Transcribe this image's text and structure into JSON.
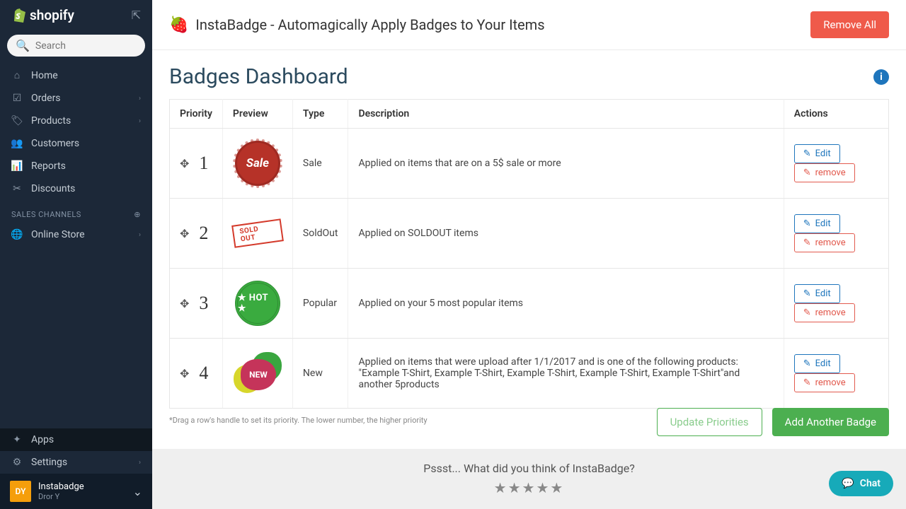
{
  "sidebar": {
    "brand": "shopify",
    "search_placeholder": "Search",
    "items": [
      {
        "label": "Home",
        "icon": "⌂",
        "chev": false
      },
      {
        "label": "Orders",
        "icon": "☑",
        "chev": true
      },
      {
        "label": "Products",
        "icon": "🏷",
        "chev": true
      },
      {
        "label": "Customers",
        "icon": "👥",
        "chev": false
      },
      {
        "label": "Reports",
        "icon": "📊",
        "chev": false
      },
      {
        "label": "Discounts",
        "icon": "✂",
        "chev": false
      }
    ],
    "section": "SALES CHANNELS",
    "channel": {
      "label": "Online Store",
      "icon": "🌐"
    },
    "bottom": [
      {
        "label": "Apps",
        "icon": "✦",
        "active": true
      },
      {
        "label": "Settings",
        "icon": "⚙",
        "chev": true
      }
    ],
    "account": {
      "initials": "DY",
      "store": "Instabadge",
      "user": "Dror Y"
    }
  },
  "header": {
    "title": "InstaBadge - Automagically Apply Badges to Your Items",
    "remove_all": "Remove All"
  },
  "dashboard": {
    "title": "Badges Dashboard",
    "columns": {
      "priority": "Priority",
      "preview": "Preview",
      "type": "Type",
      "description": "Description",
      "actions": "Actions"
    },
    "rows": [
      {
        "priority": "1",
        "type": "Sale",
        "description": "Applied on items that are on a 5$ sale or more",
        "badge": "sale",
        "badge_text": "Sale"
      },
      {
        "priority": "2",
        "type": "SoldOut",
        "description": "Applied on SOLDOUT items",
        "badge": "soldout",
        "badge_text": "SOLD OUT"
      },
      {
        "priority": "3",
        "type": "Popular",
        "description": "Applied on your 5 most popular items",
        "badge": "hot",
        "badge_text": "★ HOT ★"
      },
      {
        "priority": "4",
        "type": "New",
        "description": "Applied on items that were upload after 1/1/2017 and is one of the following products: \"Example T-Shirt, Example T-Shirt, Example T-Shirt, Example T-Shirt, Example T-Shirt\"and another 5products",
        "badge": "new",
        "badge_text": "NEW"
      }
    ],
    "edit_label": "Edit",
    "remove_label": "remove",
    "hint": "*Drag a row's handle to set its priority. The lower number, the higher priority",
    "update_btn": "Update Priorities",
    "add_btn": "Add Another Badge"
  },
  "footer": {
    "prompt": "Pssst... What did you think of InstaBadge?"
  },
  "chat": {
    "label": "Chat"
  }
}
